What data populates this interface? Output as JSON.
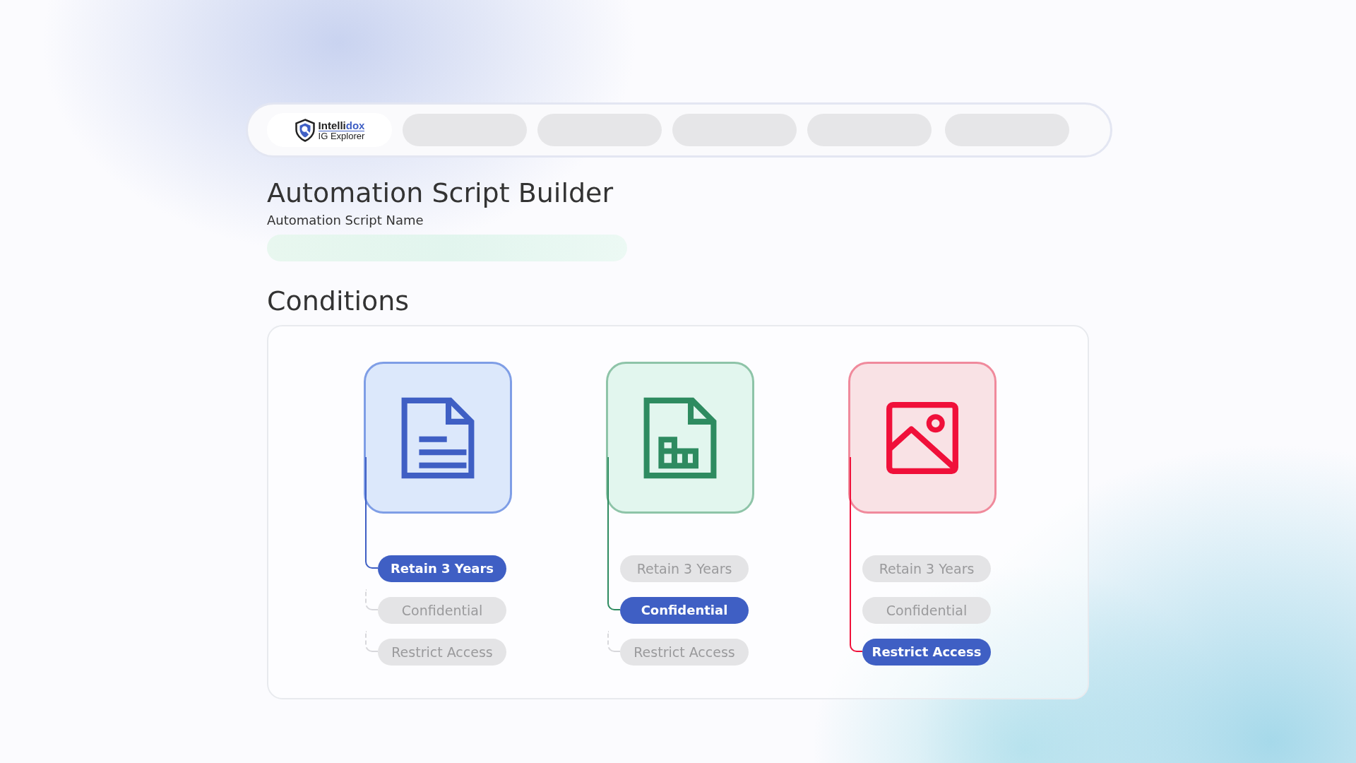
{
  "nav": {
    "logo": {
      "name_start": "Intelli",
      "name_end": "dox",
      "subtitle": "IG Explorer"
    },
    "items": [
      {
        "kind": "placeholder"
      },
      {
        "kind": "placeholder"
      },
      {
        "kind": "placeholder"
      },
      {
        "kind": "placeholder"
      },
      {
        "kind": "placeholder"
      }
    ]
  },
  "title": "Automation Script Builder",
  "script_name_field": {
    "label": "Automation Script Name"
  },
  "conditions_heading": "Conditions",
  "conditions": [
    {
      "kind": "document",
      "color": "#3f5fc4",
      "options": [
        {
          "label": "Retain 3 Years",
          "selected": true
        },
        {
          "label": "Confidential",
          "selected": false
        },
        {
          "label": "Restrict Access",
          "selected": false
        }
      ]
    },
    {
      "kind": "spreadsheet",
      "color": "#2e8b60",
      "options": [
        {
          "label": "Retain 3 Years",
          "selected": false
        },
        {
          "label": "Confidential",
          "selected": true
        },
        {
          "label": "Restrict Access",
          "selected": false
        }
      ]
    },
    {
      "kind": "image",
      "color": "#f0103a",
      "options": [
        {
          "label": "Retain 3 Years",
          "selected": false
        },
        {
          "label": "Confidential",
          "selected": false
        },
        {
          "label": "Restrict Access",
          "selected": true
        }
      ]
    }
  ]
}
